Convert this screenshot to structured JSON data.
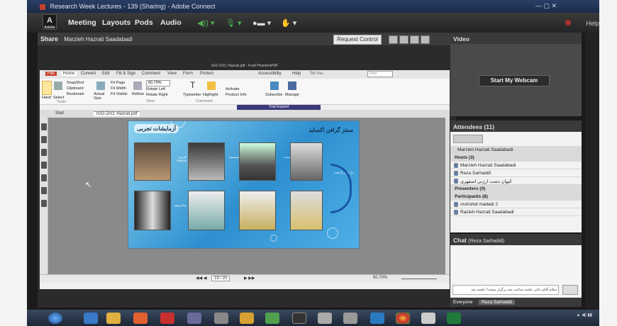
{
  "window_title": "Research Week Lectures - 139 (Sharing) - Adobe Connect",
  "connect": {
    "logo": "Adobe",
    "menu": [
      "Meeting",
      "Layouts",
      "Pods",
      "Audio"
    ],
    "help": "Help"
  },
  "share": {
    "title": "Share",
    "presenter": "Marzieh Hazrati Saadabadi",
    "request_control": "Request Control"
  },
  "pdf": {
    "title": "rGO-ZnO, Hazrati.pdf - Foxit PhantomPDF",
    "tabs": [
      "File",
      "Home",
      "Convert",
      "Edit",
      "Fill & Sign",
      "Comment",
      "View",
      "Form",
      "Protect",
      "Accessibility",
      "Help"
    ],
    "tell_me": "Tell me...",
    "find_placeholder": "Find",
    "ribbon": {
      "hand": "Hand",
      "select": "Select",
      "snapshot": "SnapShot",
      "clipboard": "Clipboard",
      "bookmark": "Bookmark",
      "actual_size": "Actual Size",
      "fit_page": "Fit Page",
      "fit_width": "Fit Width",
      "fit_visible": "Fit Visible",
      "reflow": "Reflow",
      "zoom": "60.70%",
      "rotate_left": "Rotate Left",
      "rotate_right": "Rotate Right",
      "typewriter": "Typewriter",
      "highlight": "Highlight",
      "activate": "Activate",
      "product_info": "Product Info",
      "subscribe": "Subscribe",
      "manage": "Manage",
      "group_tools": "Tools",
      "group_view": "View",
      "group_comment": "Comment",
      "trial": "Trial Expired"
    },
    "doc_tabs": [
      "Start",
      "rGO-ZnO, Hazrati.pdf"
    ],
    "status": {
      "page": "19 / 25",
      "zoom": "60.70%"
    },
    "slide": {
      "title_left": "آزمایشات تجربی",
      "title_right": "سنتز گرافن اکساید",
      "labels": [
        "افزودن KMnO4",
        "شستشو",
        "پساب",
        "حل کردن گرافیت",
        "سانتریفیوژ"
      ]
    }
  },
  "video": {
    "title": "Video",
    "webcam_button": "Start My Webcam"
  },
  "attendees": {
    "title": "Attendees",
    "count": "(11)",
    "me": "Marzieh Hazrati Saadabadi",
    "hosts_label": "Hosts (3)",
    "hosts": [
      "Marzieh Hazrati Saadabadi",
      "Reza Sarhaddi",
      "کیوان دشت ارژنی اسفهری"
    ],
    "presenters_label": "Presenters (0)",
    "participants_label": "Participants (8)",
    "participants": [
      "mohshid madadi 2",
      "Razieh Hazrati Saadabadi"
    ]
  },
  "chat": {
    "title": "Chat",
    "subtitle": "(Reza Sarhaddi)",
    "input_text": "سلام آقای دکتر، جلسه ساعت چند برگزار میشه؟ جلسه بعد",
    "tabs": [
      "Everyone",
      "Reza Sarhaddi"
    ]
  },
  "colors": {
    "slide_blue": "#2d8fcf",
    "adobe_red": "#c7402c"
  }
}
